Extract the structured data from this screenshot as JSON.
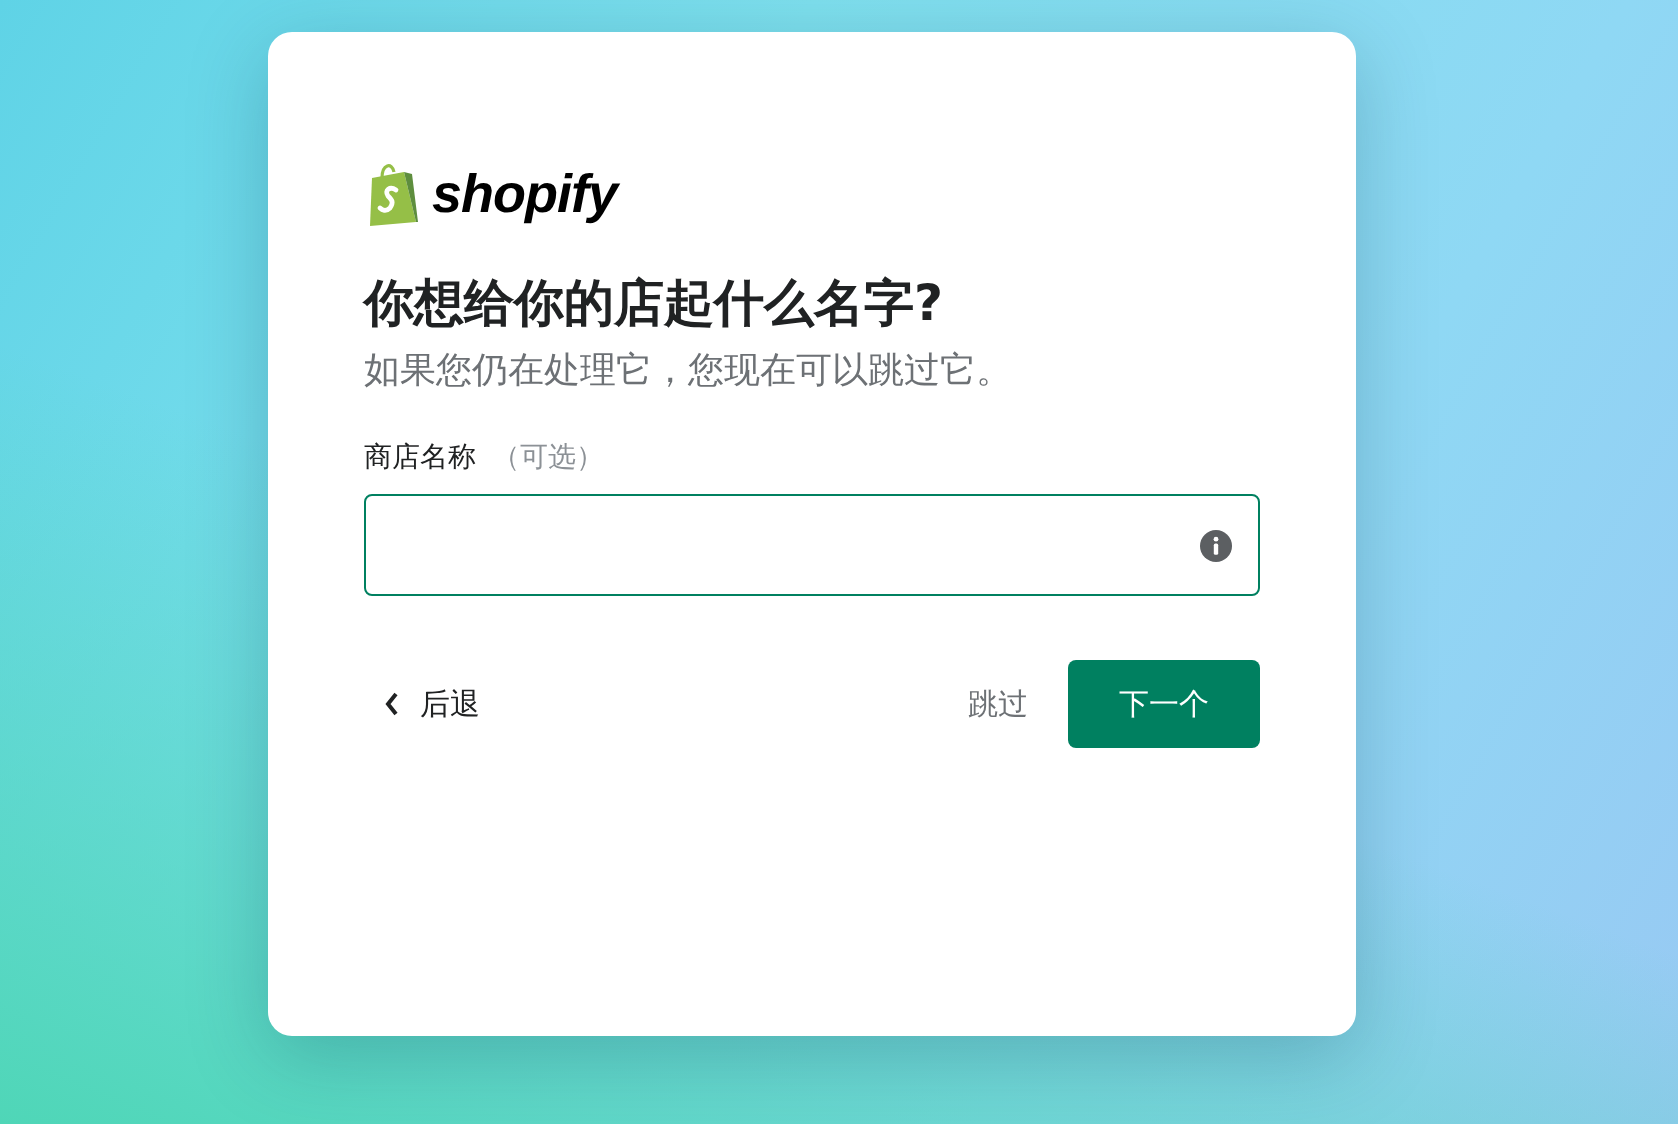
{
  "logo": {
    "text": "shopify"
  },
  "title": "你想给你的店起什么名字?",
  "subtitle": "如果您仍在处理它，您现在可以跳过它。",
  "field": {
    "label": "商店名称",
    "hint": "（可选）"
  },
  "back_link": {
    "label": "后退"
  },
  "buttons": [
    {
      "kind": "link",
      "label": "跳过"
    },
    {
      "kind": "primary",
      "label": "下一个"
    }
  ]
}
